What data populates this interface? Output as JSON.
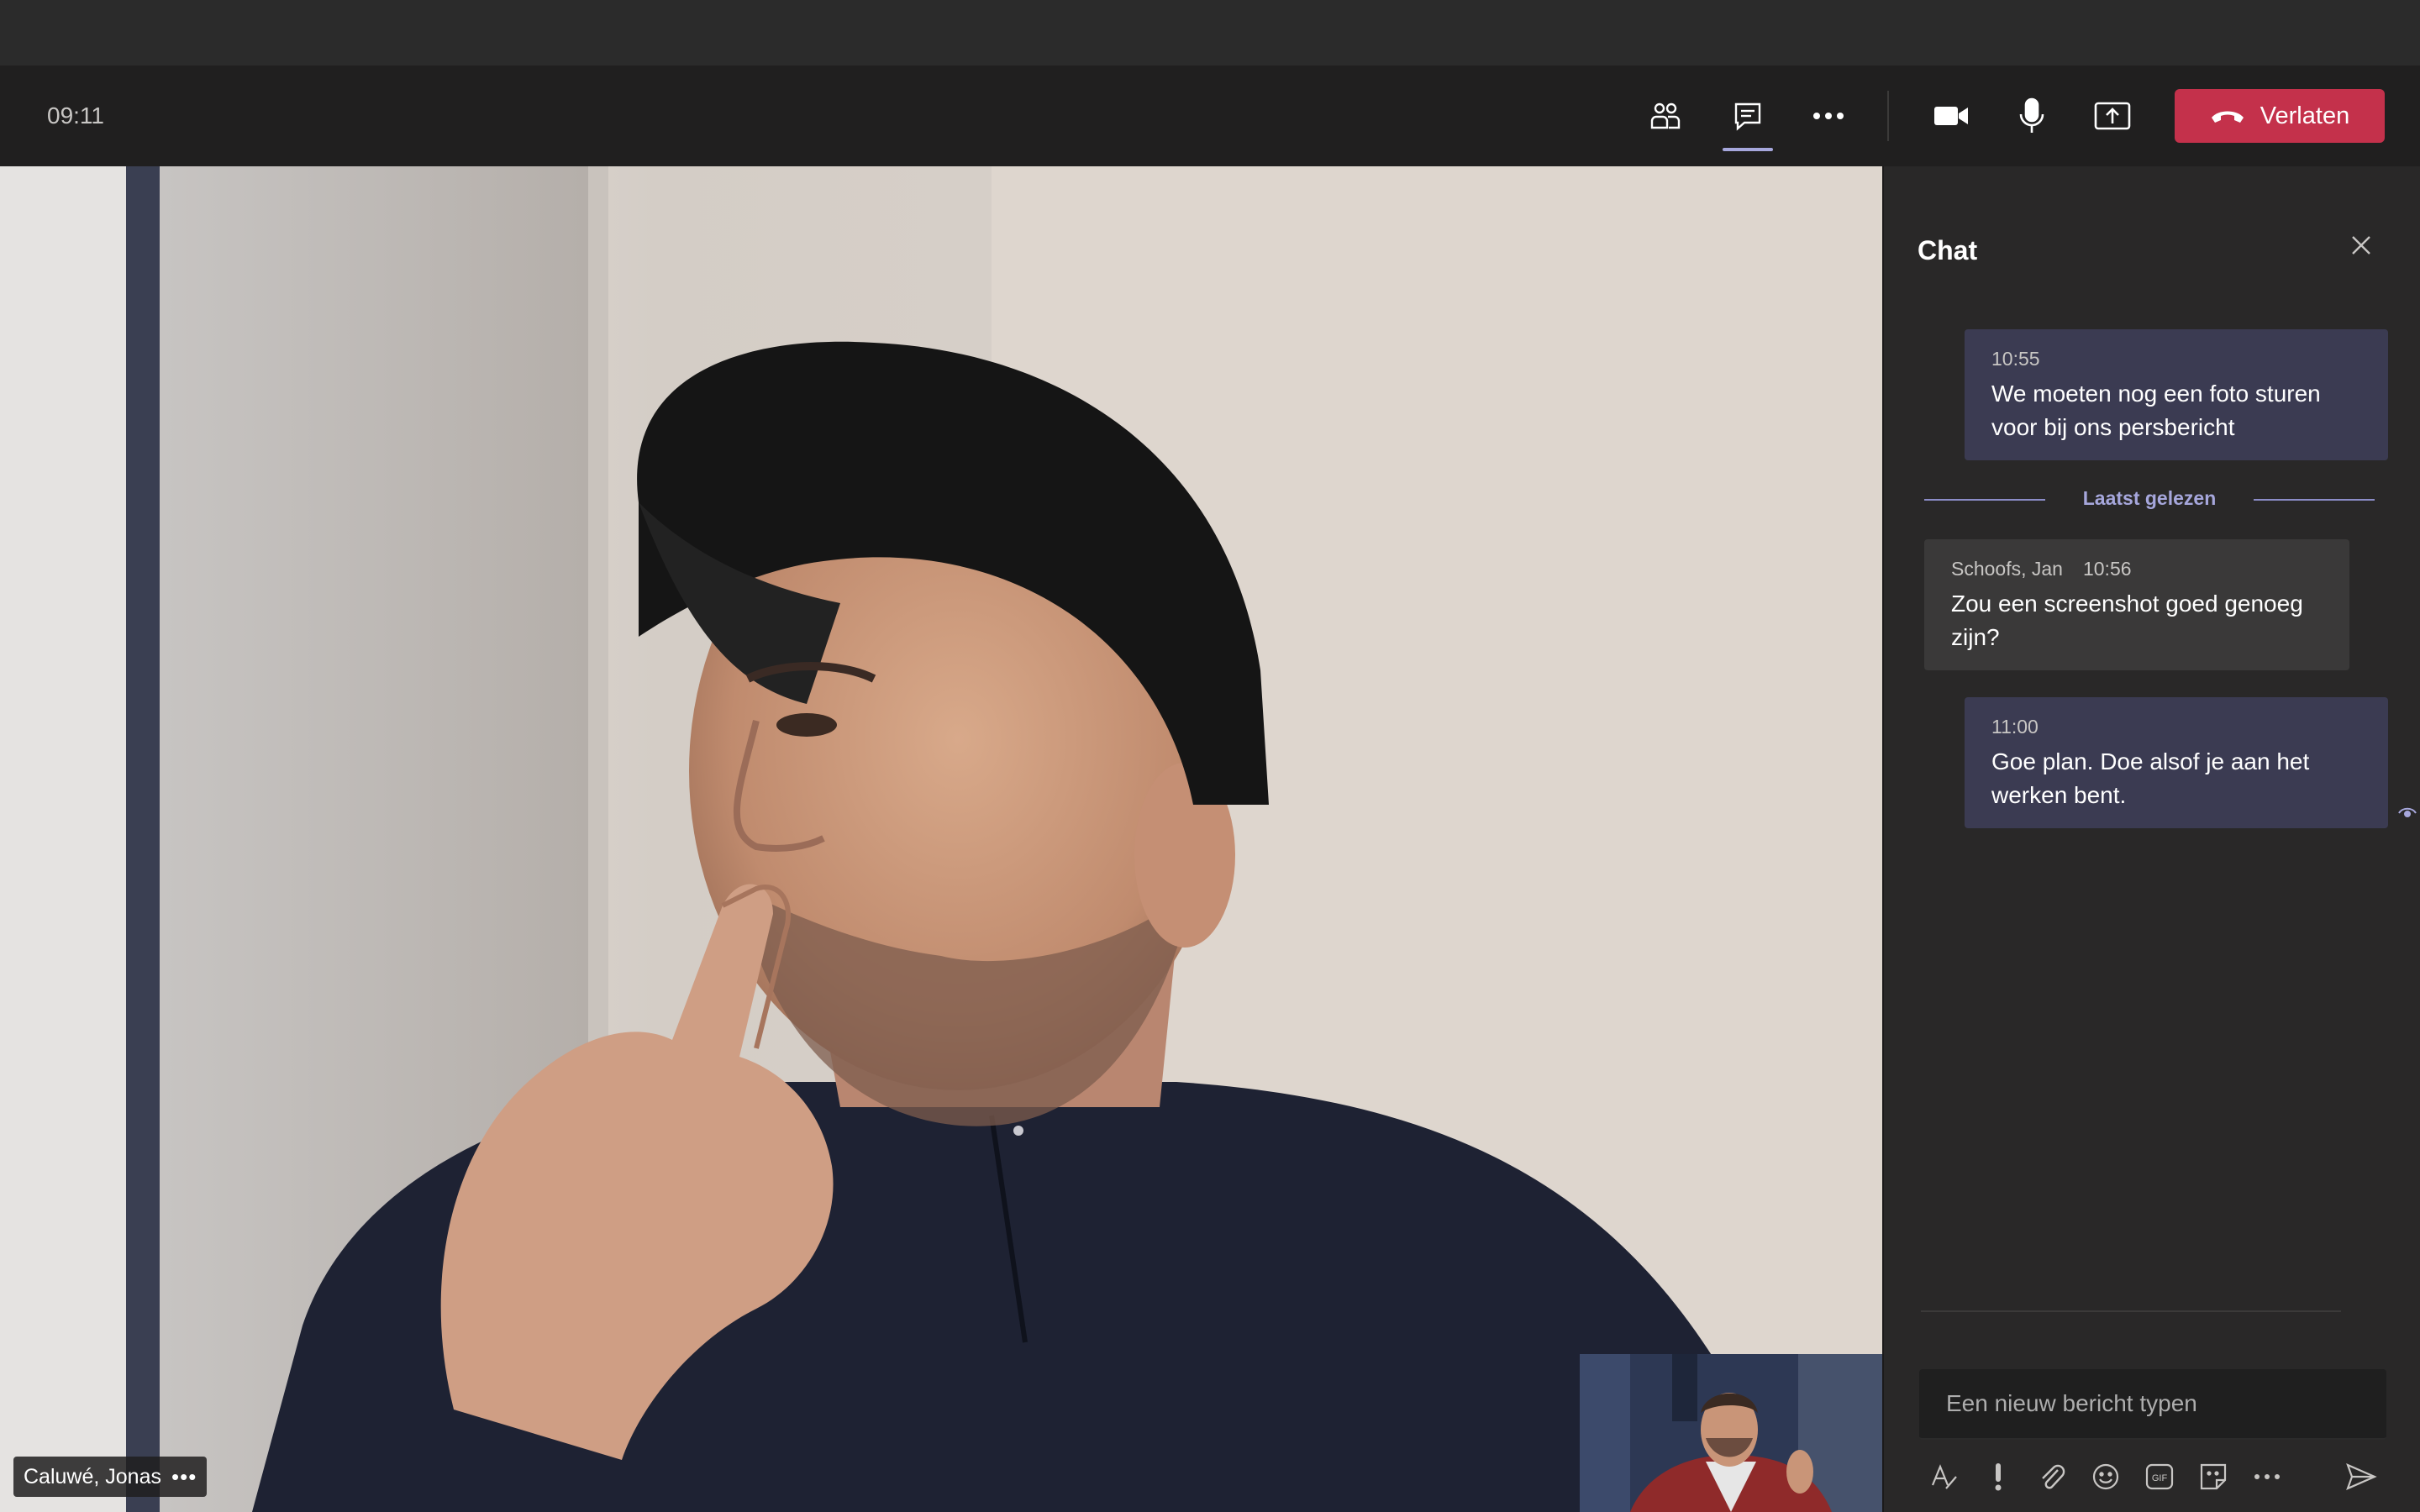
{
  "toolbar": {
    "time": "09:11",
    "buttons": [
      {
        "icon": "people-icon"
      },
      {
        "icon": "chat-icon",
        "active": true
      },
      {
        "icon": "more-actions-icon"
      },
      {
        "icon": "camera-icon"
      },
      {
        "icon": "microphone-icon"
      },
      {
        "icon": "share-screen-icon"
      }
    ],
    "leave_label": "Verlaten",
    "leave_color": "#c4314b"
  },
  "video": {
    "participant_name": "Caluwé, Jonas",
    "participant_more": "•••"
  },
  "chat": {
    "title": "Chat",
    "messages": [
      {
        "author": "",
        "time": "10:55",
        "text": "We moeten nog een foto sturen voor bij ons persbericht",
        "mine": true
      },
      {
        "author": "Schoofs, Jan",
        "time": "10:56",
        "text": "Zou een screenshot goed genoeg zijn?",
        "mine": false
      },
      {
        "author": "",
        "time": "11:00",
        "text": "Goe plan. Doe alsof je aan het werken bent.",
        "mine": true
      }
    ],
    "last_read_label": "Laatst gelezen",
    "composer_placeholder": "Een nieuw bericht typen",
    "compose_tools": [
      "format-icon",
      "important-icon",
      "attach-icon",
      "emoji-icon",
      "gif-icon",
      "sticker-icon",
      "more-options-icon",
      "send-icon"
    ]
  },
  "colors": {
    "accent": "#a6a7dc",
    "my_bubble": "#3b3b52",
    "other_bubble": "#3a3939",
    "panel": "#292828",
    "toolbar": "#201f1f"
  }
}
